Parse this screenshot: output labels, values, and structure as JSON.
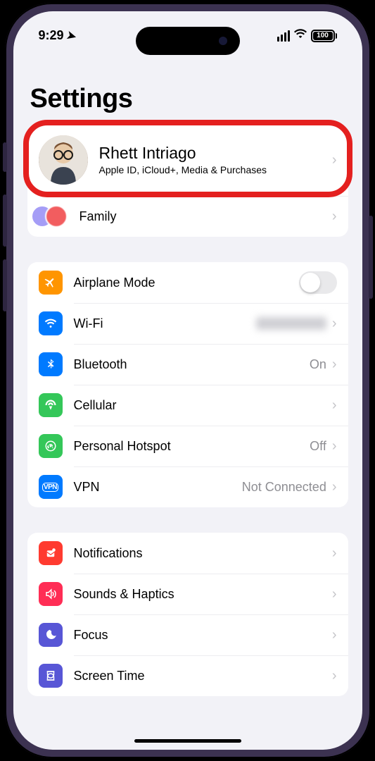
{
  "status": {
    "time": "9:29",
    "battery": "100"
  },
  "title": "Settings",
  "profile": {
    "name": "Rhett Intriago",
    "sub": "Apple ID, iCloud+, Media & Purchases",
    "family": "Family"
  },
  "network": {
    "airplane": "Airplane Mode",
    "wifi": "Wi-Fi",
    "bluetooth": {
      "label": "Bluetooth",
      "value": "On"
    },
    "cellular": "Cellular",
    "hotspot": {
      "label": "Personal Hotspot",
      "value": "Off"
    },
    "vpn": {
      "label": "VPN",
      "value": "Not Connected"
    }
  },
  "system": {
    "notifications": "Notifications",
    "sounds": "Sounds & Haptics",
    "focus": "Focus",
    "screentime": "Screen Time"
  }
}
